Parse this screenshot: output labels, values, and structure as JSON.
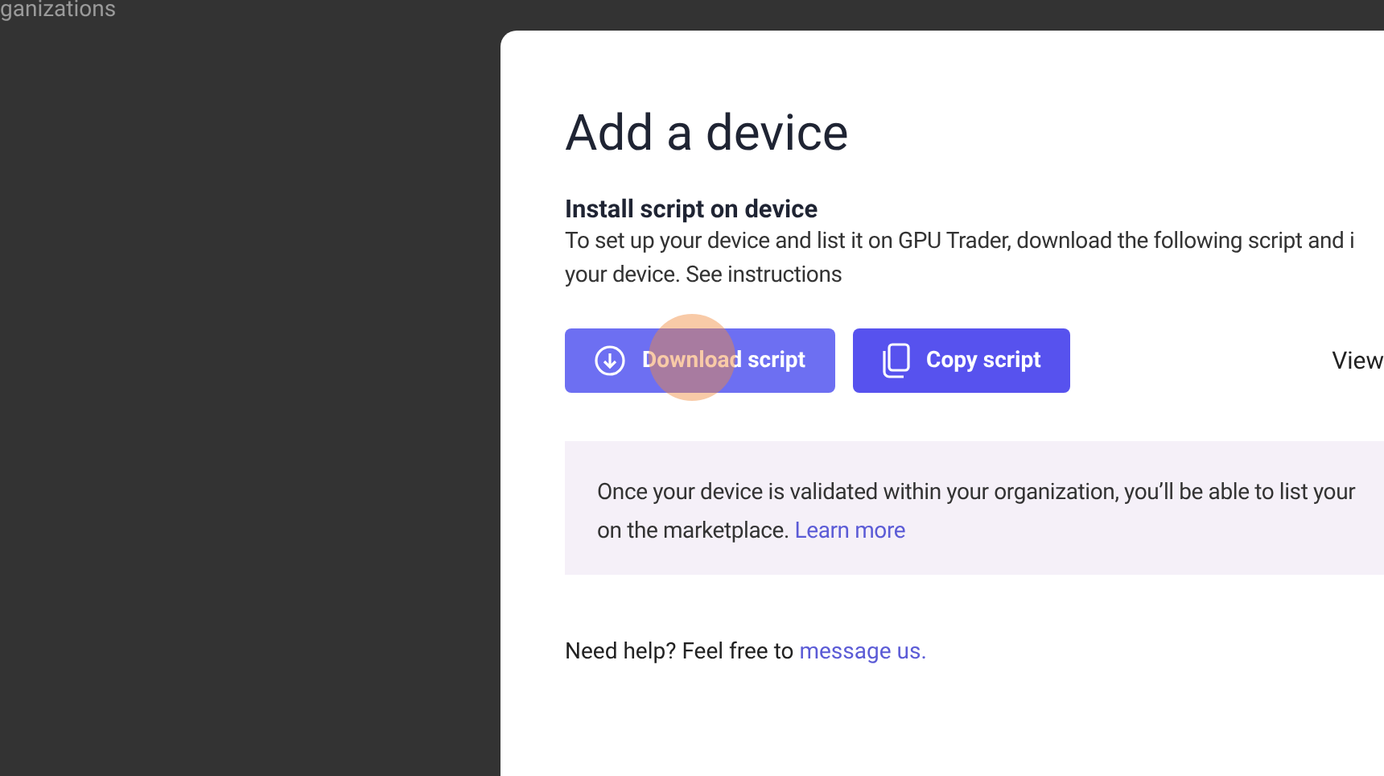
{
  "background": {
    "text": "ganizations"
  },
  "dialog": {
    "title": "Add a device",
    "section_title": "Install script on device",
    "description_lines": [
      "To set up your device and list it on GPU Trader, download the following script and i",
      "your device. See instructions"
    ],
    "buttons": [
      {
        "label": "Download script",
        "kind": "download"
      },
      {
        "label": "Copy script",
        "kind": "copy"
      }
    ],
    "view_link": "View",
    "info": {
      "text": "Once your device is validated within your organization, you’ll be able to list your",
      "text_end": "on the marketplace.",
      "link": "Learn more"
    },
    "help": {
      "text": "Need help? Feel free to",
      "link": "message us."
    }
  }
}
